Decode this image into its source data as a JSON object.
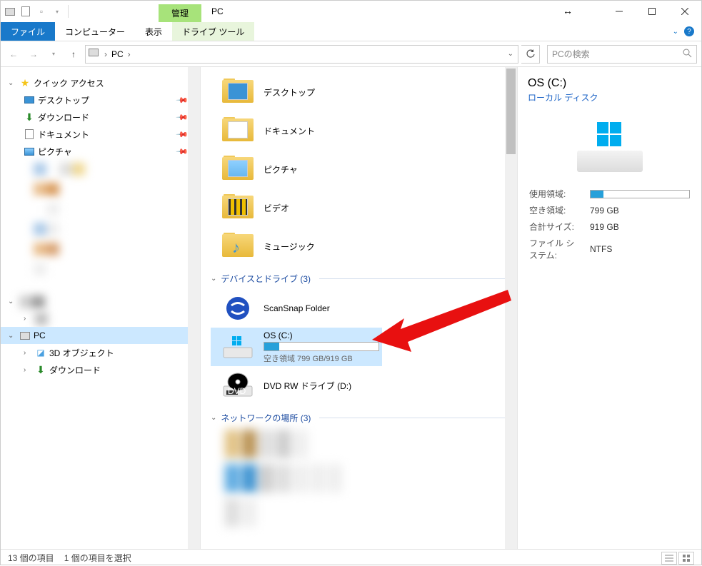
{
  "window": {
    "context_tab": "管理",
    "title": "PC"
  },
  "ribbon": {
    "file": "ファイル",
    "tabs": [
      "コンピューター",
      "表示"
    ],
    "context_tab": "ドライブ ツール"
  },
  "nav": {
    "breadcrumb": [
      "PC"
    ],
    "search_placeholder": "PCの検索"
  },
  "sidebar": {
    "quick_access": "クイック アクセス",
    "items": [
      {
        "label": "デスクトップ",
        "icon": "desktop"
      },
      {
        "label": "ダウンロード",
        "icon": "download"
      },
      {
        "label": "ドキュメント",
        "icon": "document"
      },
      {
        "label": "ピクチャ",
        "icon": "picture"
      }
    ],
    "pc": "PC",
    "pc_children": [
      "3D オブジェクト",
      "ダウンロード"
    ]
  },
  "content": {
    "folders": [
      {
        "label": "デスクトップ",
        "icon": "desktop"
      },
      {
        "label": "ドキュメント",
        "icon": "document"
      },
      {
        "label": "ピクチャ",
        "icon": "picture"
      },
      {
        "label": "ビデオ",
        "icon": "video"
      },
      {
        "label": "ミュージック",
        "icon": "music"
      }
    ],
    "devices_header": "デバイスとドライブ (3)",
    "devices": [
      {
        "label": "ScanSnap Folder",
        "type": "app"
      },
      {
        "label": "OS (C:)",
        "type": "drive",
        "sub": "空き領域 799 GB/919 GB",
        "selected": true
      },
      {
        "label": "DVD RW ドライブ (D:)",
        "type": "dvd"
      }
    ],
    "network_header": "ネットワークの場所 (3)"
  },
  "details": {
    "title": "OS (C:)",
    "subtitle": "ローカル ディスク",
    "props": [
      {
        "k": "使用領域:",
        "v": ""
      },
      {
        "k": "空き領域:",
        "v": "799 GB"
      },
      {
        "k": "合計サイズ:",
        "v": "919 GB"
      },
      {
        "k": "ファイル システム:",
        "v": "NTFS"
      }
    ]
  },
  "status": {
    "items_count": "13 個の項目",
    "selected": "1 個の項目を選択"
  }
}
